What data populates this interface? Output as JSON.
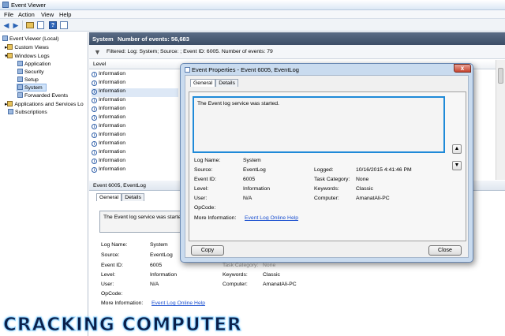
{
  "window": {
    "title": "Event Viewer"
  },
  "menu": [
    "File",
    "Action",
    "View",
    "Help"
  ],
  "toolbar": {
    "icons": [
      "back-arrow-icon",
      "forward-arrow-icon",
      "folder-icon",
      "properties-icon",
      "help-icon",
      "panel-icon"
    ]
  },
  "tree": {
    "root": "Event Viewer (Local)",
    "custom_views": "Custom Views",
    "windows_logs": "Windows Logs",
    "application": "Application",
    "security": "Security",
    "setup": "Setup",
    "system": "System",
    "forwarded": "Forwarded Events",
    "apps_services": "Applications and Services Lo",
    "subscriptions": "Subscriptions"
  },
  "main": {
    "header_name": "System",
    "header_count": "Number of events: 56,683",
    "filter": "Filtered: Log: System; Source: ; Event ID: 6005. Number of events: 79",
    "column_level": "Level",
    "rows": [
      "Information",
      "Information",
      "Information",
      "Information",
      "Information",
      "Information",
      "Information",
      "Information",
      "Information",
      "Information",
      "Information",
      "Information"
    ]
  },
  "lower": {
    "title": "Event 6005, EventLog",
    "tab_general": "General",
    "tab_details": "Details",
    "message": "The Event log service was started.",
    "log_name_label": "Log Name:",
    "log_name": "System",
    "source_label": "Source:",
    "source": "EventLog",
    "event_id_label": "Event ID:",
    "event_id": "6005",
    "task_label": "Task Category:",
    "task": "None",
    "level_label": "Level:",
    "level": "Information",
    "keywords_label": "Keywords:",
    "keywords": "Classic",
    "user_label": "User:",
    "user": "N/A",
    "computer_label": "Computer:",
    "computer": "AmanatAli-PC",
    "opcode_label": "OpCode:",
    "more_label": "More Information:",
    "more_link": "Event Log Online Help"
  },
  "dialog": {
    "title": "Event Properties - Event 6005, EventLog",
    "tab_general": "General",
    "tab_details": "Details",
    "message": "The Event log service was started.",
    "log_name_label": "Log Name:",
    "log_name": "System",
    "source_label": "Source:",
    "source": "EventLog",
    "logged_label": "Logged:",
    "logged": "10/16/2015 4:41:46 PM",
    "event_id_label": "Event ID:",
    "event_id": "6005",
    "task_label": "Task Category:",
    "task": "None",
    "level_label": "Level:",
    "level": "Information",
    "keywords_label": "Keywords:",
    "keywords": "Classic",
    "user_label": "User:",
    "user": "N/A",
    "computer_label": "Computer:",
    "computer": "AmanatAli-PC",
    "opcode_label": "OpCode:",
    "more_label": "More Information:",
    "more_link": "Event Log Online Help",
    "copy": "Copy",
    "close": "Close",
    "up_glyph": "▲",
    "down_glyph": "▼",
    "close_glyph": "x"
  },
  "watermark": "CRACKING COMPUTER",
  "colors": {
    "accent": "#1f8ad8",
    "header": "#4a5b76",
    "link": "#1a4fd0",
    "dialog_frame": "#c9dbef"
  }
}
